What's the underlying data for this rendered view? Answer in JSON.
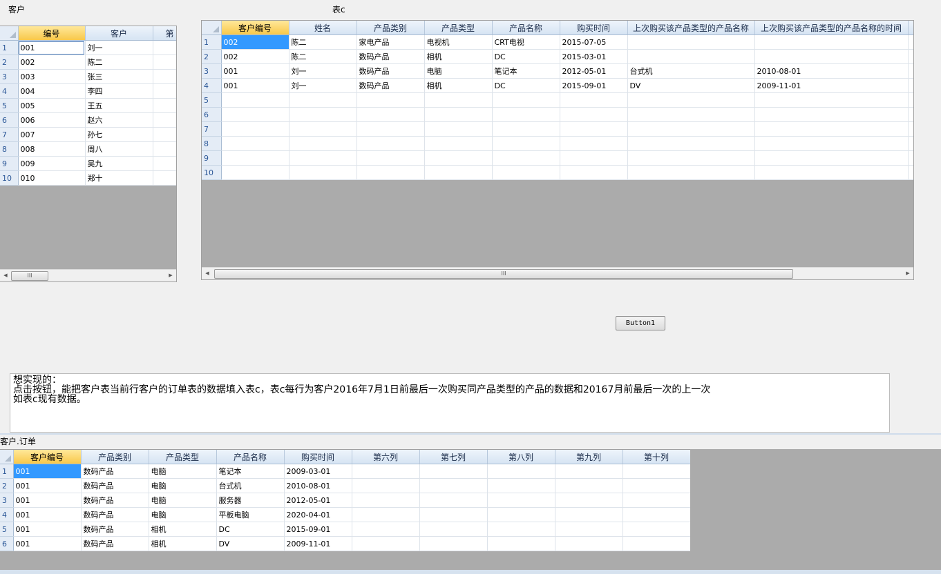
{
  "labels": {
    "customer": "客户",
    "table_c": "表c",
    "orders": "客户.订单"
  },
  "customer_grid": {
    "headers": [
      "编号",
      "客户",
      "第"
    ],
    "rows": [
      [
        "1",
        "001",
        "刘一"
      ],
      [
        "2",
        "002",
        "陈二"
      ],
      [
        "3",
        "003",
        "张三"
      ],
      [
        "4",
        "004",
        "李四"
      ],
      [
        "5",
        "005",
        "王五"
      ],
      [
        "6",
        "006",
        "赵六"
      ],
      [
        "7",
        "007",
        "孙七"
      ],
      [
        "8",
        "008",
        "周八"
      ],
      [
        "9",
        "009",
        "吴九"
      ],
      [
        "10",
        "010",
        "郑十"
      ]
    ]
  },
  "table_c": {
    "headers": [
      "客户编号",
      "姓名",
      "产品类别",
      "产品类型",
      "产品名称",
      "购买时间",
      "上次购买该产品类型的产品名称",
      "上次购买该产品类型的产品名称的时间"
    ],
    "rows": [
      [
        "1",
        "002",
        "陈二",
        "家电产品",
        "电视机",
        "CRT电视",
        "2015-07-05",
        "",
        ""
      ],
      [
        "2",
        "002",
        "陈二",
        "数码产品",
        "相机",
        "DC",
        "2015-03-01",
        "",
        ""
      ],
      [
        "3",
        "001",
        "刘一",
        "数码产品",
        "电脑",
        "笔记本",
        "2012-05-01",
        "台式机",
        "2010-08-01"
      ],
      [
        "4",
        "001",
        "刘一",
        "数码产品",
        "相机",
        "DC",
        "2015-09-01",
        "DV",
        "2009-11-01"
      ],
      [
        "5",
        "",
        "",
        "",
        "",
        "",
        "",
        "",
        ""
      ],
      [
        "6",
        "",
        "",
        "",
        "",
        "",
        "",
        "",
        ""
      ],
      [
        "7",
        "",
        "",
        "",
        "",
        "",
        "",
        "",
        ""
      ],
      [
        "8",
        "",
        "",
        "",
        "",
        "",
        "",
        "",
        ""
      ],
      [
        "9",
        "",
        "",
        "",
        "",
        "",
        "",
        "",
        ""
      ],
      [
        "10",
        "",
        "",
        "",
        "",
        "",
        "",
        "",
        ""
      ]
    ]
  },
  "button": {
    "label": "Button1"
  },
  "memo": {
    "lines": [
      "想实现的：",
      "点击按钮，能把客户表当前行客户的订单表的数据填入表c，表c每行为客户2016年7月1日前最后一次购买同产品类型的产品的数据和20167月前最后一次的上一次",
      "如表c现有数据。"
    ]
  },
  "orders_grid": {
    "headers": [
      "客户编号",
      "产品类别",
      "产品类型",
      "产品名称",
      "购买时间",
      "第六列",
      "第七列",
      "第八列",
      "第九列",
      "第十列"
    ],
    "rows": [
      [
        "1",
        "001",
        "数码产品",
        "电脑",
        "笔记本",
        "2009-03-01",
        "",
        "",
        "",
        "",
        ""
      ],
      [
        "2",
        "001",
        "数码产品",
        "电脑",
        "台式机",
        "2010-08-01",
        "",
        "",
        "",
        "",
        ""
      ],
      [
        "3",
        "001",
        "数码产品",
        "电脑",
        "服务器",
        "2012-05-01",
        "",
        "",
        "",
        "",
        ""
      ],
      [
        "4",
        "001",
        "数码产品",
        "电脑",
        "平板电脑",
        "2020-04-01",
        "",
        "",
        "",
        "",
        ""
      ],
      [
        "5",
        "001",
        "数码产品",
        "相机",
        "DC",
        "2015-09-01",
        "",
        "",
        "",
        "",
        ""
      ],
      [
        "6",
        "001",
        "数码产品",
        "相机",
        "DV",
        "2009-11-01",
        "",
        "",
        "",
        "",
        ""
      ]
    ]
  },
  "scrollbar": {
    "left_arrow": "◀",
    "right_arrow": "▶",
    "grip": "III"
  }
}
